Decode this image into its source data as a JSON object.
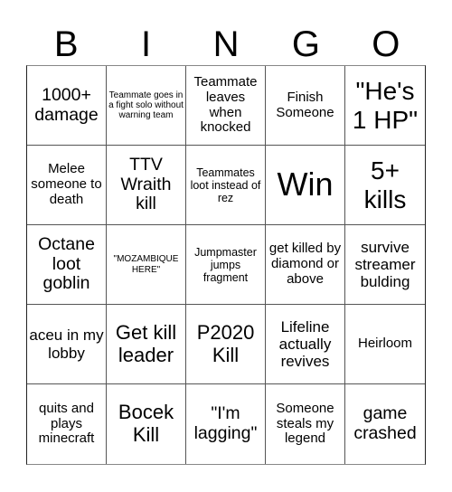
{
  "header": {
    "letters": [
      "B",
      "I",
      "N",
      "G",
      "O"
    ]
  },
  "cells": [
    "1000+ damage",
    "Teammate goes in a fight solo without warning team",
    "Teammate leaves when knocked",
    "Finish Someone",
    "\"He's 1 HP\"",
    "Melee someone to death",
    "TTV Wraith kill",
    "Teammates loot instead of rez",
    "Win",
    "5+ kills",
    "Octane loot goblin",
    "\"MOZAMBIQUE HERE\"",
    "Jumpmaster jumps fragment",
    "get killed by diamond or above",
    "survive streamer bulding",
    "aceu in my lobby",
    "Get kill leader",
    "P2020 Kill",
    "Lifeline actually revives",
    "Heirloom",
    "quits and plays minecraft",
    "Bocek Kill",
    "\"I'm lagging\"",
    "Someone steals my legend",
    "game crashed"
  ]
}
